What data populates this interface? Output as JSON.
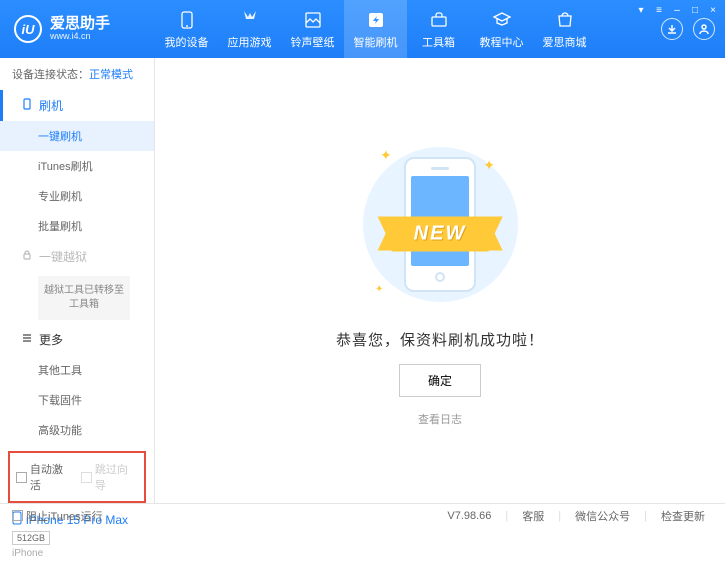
{
  "app": {
    "name": "爱思助手",
    "url": "www.i4.cn"
  },
  "nav": [
    {
      "label": "我的设备"
    },
    {
      "label": "应用游戏"
    },
    {
      "label": "铃声壁纸"
    },
    {
      "label": "智能刷机"
    },
    {
      "label": "工具箱"
    },
    {
      "label": "教程中心"
    },
    {
      "label": "爱思商城"
    }
  ],
  "conn_status": {
    "label": "设备连接状态：",
    "value": "正常模式"
  },
  "sidebar": {
    "flash": {
      "label": "刷机"
    },
    "flash_items": [
      {
        "label": "一键刷机"
      },
      {
        "label": "iTunes刷机"
      },
      {
        "label": "专业刷机"
      },
      {
        "label": "批量刷机"
      }
    ],
    "jailbreak": {
      "label": "一键越狱"
    },
    "jailbreak_note": "越狱工具已转移至工具箱",
    "more": {
      "label": "更多"
    },
    "more_items": [
      {
        "label": "其他工具"
      },
      {
        "label": "下载固件"
      },
      {
        "label": "高级功能"
      }
    ],
    "checks": {
      "auto_activate": "自动激活",
      "skip_guide": "跳过向导"
    }
  },
  "device": {
    "name": "iPhone 15 Pro Max",
    "storage": "512GB",
    "type": "iPhone"
  },
  "content": {
    "new_badge": "NEW",
    "message": "恭喜您，保资料刷机成功啦！",
    "ok": "确定",
    "view_log": "查看日志"
  },
  "status": {
    "block_itunes": "阻止iTunes运行",
    "version": "V7.98.66",
    "links": [
      "客服",
      "微信公众号",
      "检查更新"
    ]
  }
}
